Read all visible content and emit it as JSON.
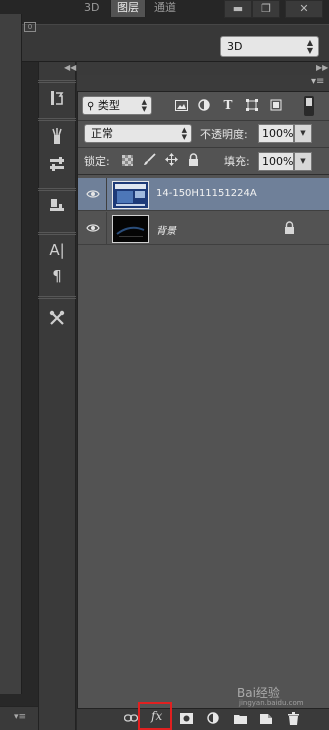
{
  "window": {
    "minimize_label": "▬",
    "maximize_label": "❐",
    "close_label": "✕"
  },
  "options_bar": {
    "workspace_value": "3D"
  },
  "document": {
    "ruler_label": "0"
  },
  "layers_panel": {
    "tabs": [
      {
        "label": "3D",
        "active": false
      },
      {
        "label": "图层",
        "active": true
      },
      {
        "label": "通道",
        "active": false
      }
    ],
    "filter": {
      "value": "类型"
    },
    "blend_mode": {
      "value": "正常"
    },
    "opacity": {
      "label": "不透明度:",
      "value": "100%"
    },
    "lock": {
      "label": "锁定:"
    },
    "fill": {
      "label": "填充:",
      "value": "100%"
    },
    "layers": [
      {
        "name": "14-150H11151224A",
        "visible": true,
        "selected": true,
        "locked": false
      },
      {
        "name": "背景",
        "visible": true,
        "selected": false,
        "locked": true
      }
    ],
    "bottom": {
      "fx_label": "fx"
    }
  },
  "watermark": {
    "text": "Bai经验",
    "sub": "jingyan.baidu.com"
  },
  "colors": {
    "panel_bg": "#535353",
    "selected_layer": "#6f8099",
    "highlight_box": "#e02020"
  },
  "icons": [
    "collapse-icon",
    "expand-icon",
    "history-icon",
    "brush-preset-icon",
    "adjust-icon",
    "clone-source-icon",
    "character-icon",
    "paragraph-icon",
    "tool-preset-icon",
    "image-filter-icon",
    "adjustment-filter-icon",
    "type-filter-icon",
    "shape-filter-icon",
    "smart-object-filter-icon",
    "eye-icon",
    "lock-icon",
    "link-icon",
    "mask-icon",
    "new-fill-icon",
    "folder-icon",
    "new-layer-icon",
    "trash-icon"
  ]
}
